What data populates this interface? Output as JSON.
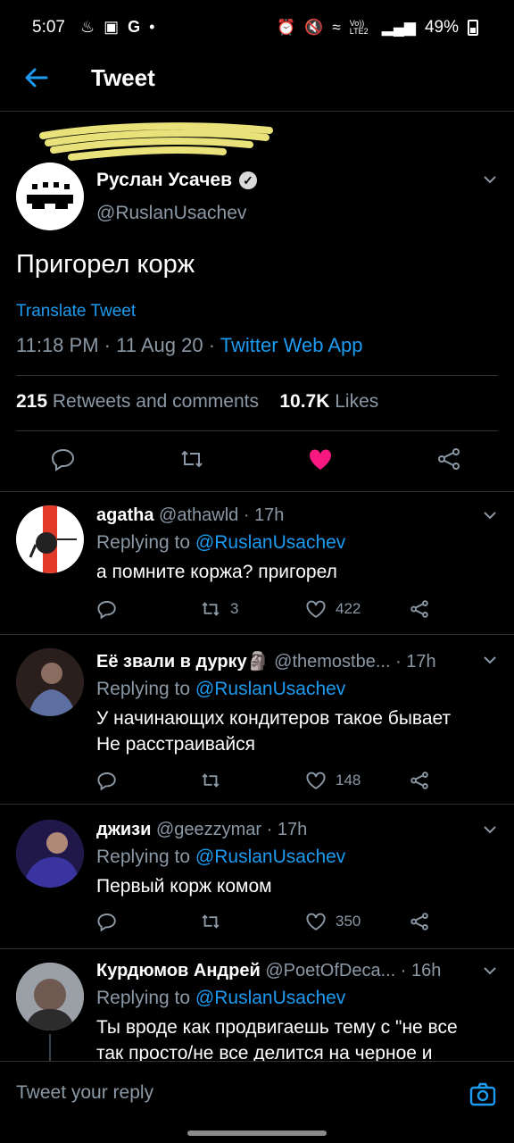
{
  "status_bar": {
    "time": "5:07",
    "left_icons": [
      "tea-icon",
      "gallery-icon",
      "google-icon",
      "dot-icon"
    ],
    "right_icons": [
      "alarm-icon",
      "mute-icon",
      "wifi-icon",
      "volte-icon",
      "signal-icon"
    ],
    "volte_label": "Vo)) LTE2",
    "battery": "49%"
  },
  "header": {
    "title": "Tweet"
  },
  "tweet": {
    "author_name": "Руслан Усачев",
    "handle": "@RuslanUsachev",
    "text": "Пригорел корж",
    "translate": "Translate Tweet",
    "time": "11:18 PM",
    "date": "11 Aug 20",
    "source": "Twitter Web App",
    "retweets_count": "215",
    "retweets_label": "Retweets and comments",
    "likes_count": "10.7K",
    "likes_label": "Likes",
    "liked": true,
    "accent_color": "#1d9bf0",
    "like_color": "#f91880"
  },
  "replies": [
    {
      "name": "agatha",
      "handle": "@athawld",
      "time": "17h",
      "replying_prefix": "Replying to",
      "replying_to": "@RuslanUsachev",
      "text": "а помните коржа? пригорел",
      "retweets": "3",
      "likes": "422"
    },
    {
      "name": "Её звали в дурку",
      "emoji": "🗿",
      "handle": "@themostbe...",
      "time": "17h",
      "replying_prefix": "Replying to",
      "replying_to": "@RuslanUsachev",
      "text_line1": "У начинающих кондитеров такое бывает",
      "text_line2": "Не расстраивайся",
      "likes": "148"
    },
    {
      "name": "джизи",
      "handle": "@geezzymar",
      "time": "17h",
      "replying_prefix": "Replying to",
      "replying_to": "@RuslanUsachev",
      "text": "Первый корж комом",
      "likes": "350"
    },
    {
      "name": "Курдюмов Андрей",
      "handle": "@PoetOfDeca...",
      "time": "16h",
      "replying_prefix": "Replying to",
      "replying_to": "@RuslanUsachev",
      "text_line1": "Ты вроде как продвигаешь тему с \"не все",
      "text_line2": "так просто/не все делится на черное и"
    }
  ],
  "composer": {
    "placeholder": "Tweet your reply"
  }
}
